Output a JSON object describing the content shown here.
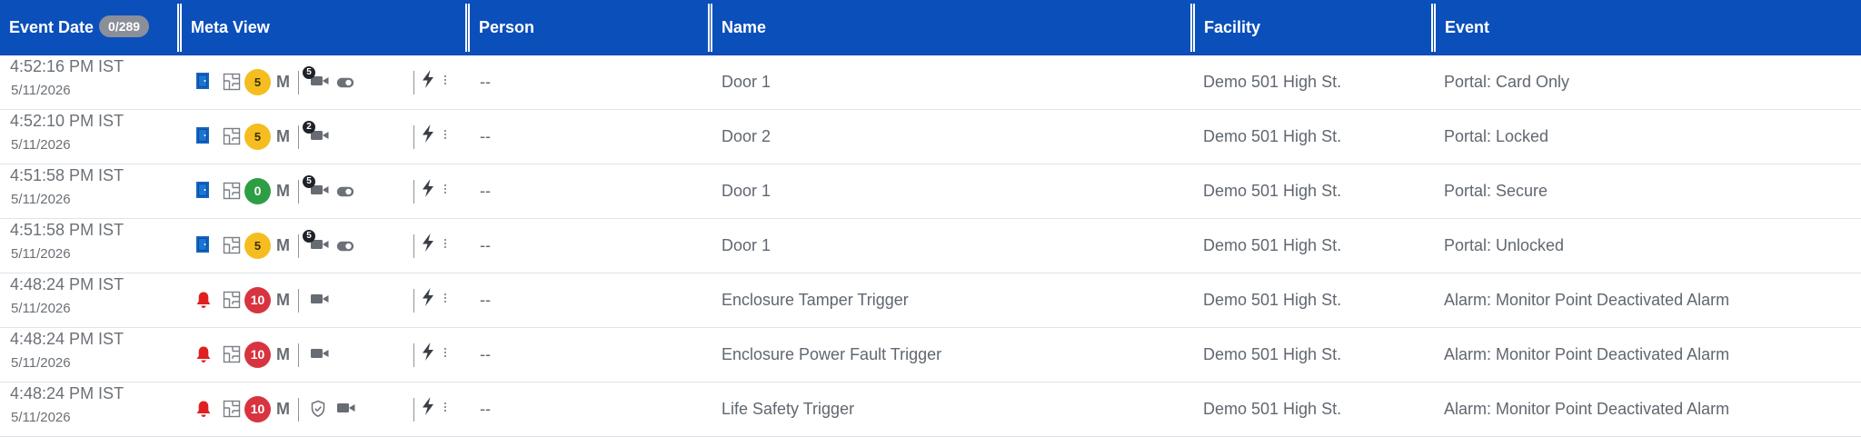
{
  "header": {
    "event_date": "Event Date",
    "count_badge": "0/289",
    "meta_view": "Meta View",
    "person": "Person",
    "name": "Name",
    "facility": "Facility",
    "event": "Event"
  },
  "colors": {
    "header_bg": "#0b4fbb",
    "door_icon": "#1565c0",
    "alarm_icon": "#e02020",
    "sev_yellow": "#f5bd1f",
    "sev_green": "#2e9e44",
    "sev_red": "#d73440"
  },
  "rows": [
    {
      "time": "4:52:16 PM IST",
      "date": "5/11/2026",
      "type_icon": "door-icon",
      "severity": "5",
      "severity_color": "yellow",
      "m": "M",
      "camera_count": "5",
      "has_toggle": true,
      "has_shield": false,
      "person": "--",
      "name": "Door 1",
      "facility": "Demo 501 High St.",
      "event": "Portal: Card Only"
    },
    {
      "time": "4:52:10 PM IST",
      "date": "5/11/2026",
      "type_icon": "door-icon",
      "severity": "5",
      "severity_color": "yellow",
      "m": "M",
      "camera_count": "2",
      "has_toggle": false,
      "has_shield": false,
      "person": "--",
      "name": "Door 2",
      "facility": "Demo 501 High St.",
      "event": "Portal: Locked"
    },
    {
      "time": "4:51:58 PM IST",
      "date": "5/11/2026",
      "type_icon": "door-icon",
      "severity": "0",
      "severity_color": "green",
      "m": "M",
      "camera_count": "5",
      "has_toggle": true,
      "has_shield": false,
      "person": "--",
      "name": "Door 1",
      "facility": "Demo 501 High St.",
      "event": "Portal: Secure"
    },
    {
      "time": "4:51:58 PM IST",
      "date": "5/11/2026",
      "type_icon": "door-icon",
      "severity": "5",
      "severity_color": "yellow",
      "m": "M",
      "camera_count": "5",
      "has_toggle": true,
      "has_shield": false,
      "person": "--",
      "name": "Door 1",
      "facility": "Demo 501 High St.",
      "event": "Portal: Unlocked"
    },
    {
      "time": "4:48:24 PM IST",
      "date": "5/11/2026",
      "type_icon": "bell-icon",
      "severity": "10",
      "severity_color": "red",
      "m": "M",
      "camera_count": "",
      "has_toggle": false,
      "has_shield": false,
      "person": "--",
      "name": "Enclosure Tamper Trigger",
      "facility": "Demo 501 High St.",
      "event": "Alarm: Monitor Point Deactivated Alarm"
    },
    {
      "time": "4:48:24 PM IST",
      "date": "5/11/2026",
      "type_icon": "bell-icon",
      "severity": "10",
      "severity_color": "red",
      "m": "M",
      "camera_count": "",
      "has_toggle": false,
      "has_shield": false,
      "person": "--",
      "name": "Enclosure Power Fault Trigger",
      "facility": "Demo 501 High St.",
      "event": "Alarm: Monitor Point Deactivated Alarm"
    },
    {
      "time": "4:48:24 PM IST",
      "date": "5/11/2026",
      "type_icon": "bell-icon",
      "severity": "10",
      "severity_color": "red",
      "m": "M",
      "camera_count": "",
      "has_toggle": false,
      "has_shield": true,
      "person": "--",
      "name": "Life Safety Trigger",
      "facility": "Demo 501 High St.",
      "event": "Alarm: Monitor Point Deactivated Alarm"
    }
  ]
}
